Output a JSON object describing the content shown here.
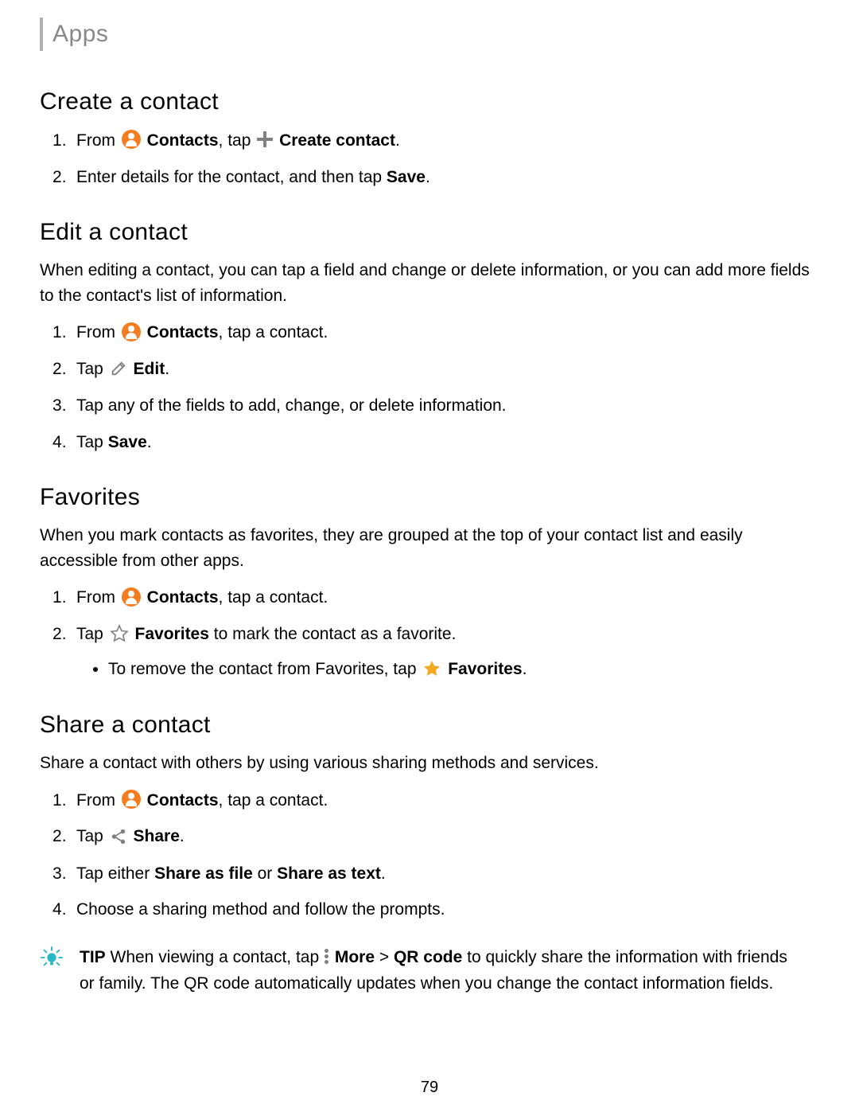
{
  "header": {
    "label": "Apps"
  },
  "sections": {
    "create": {
      "title": "Create a contact",
      "step1_a": "From ",
      "step1_contacts": "Contacts",
      "step1_b": ", tap ",
      "step1_action": "Create contact",
      "step1_c": ".",
      "step2_a": "Enter details for the contact, and then tap ",
      "step2_save": "Save",
      "step2_b": "."
    },
    "edit": {
      "title": "Edit a contact",
      "desc": "When editing a contact, you can tap a field and change or delete information, or you can add more fields to the contact's list of information.",
      "step1_a": "From ",
      "step1_contacts": "Contacts",
      "step1_b": ", tap a contact.",
      "step2_a": "Tap ",
      "step2_action": "Edit",
      "step2_b": ".",
      "step3": "Tap any of the fields to add, change, or delete information.",
      "step4_a": "Tap ",
      "step4_save": "Save",
      "step4_b": "."
    },
    "favorites": {
      "title": "Favorites",
      "desc": "When you mark contacts as favorites, they are grouped at the top of your contact list and easily accessible from other apps.",
      "step1_a": "From ",
      "step1_contacts": "Contacts",
      "step1_b": ", tap a contact.",
      "step2_a": "Tap ",
      "step2_action": "Favorites",
      "step2_b": " to mark the contact as a favorite.",
      "sub_a": "To remove the contact from Favorites, tap ",
      "sub_action": "Favorites",
      "sub_b": "."
    },
    "share": {
      "title": "Share a contact",
      "desc": "Share a contact with others by using various sharing methods and services.",
      "step1_a": "From ",
      "step1_contacts": "Contacts",
      "step1_b": ", tap a contact.",
      "step2_a": "Tap ",
      "step2_action": "Share",
      "step2_b": ".",
      "step3_a": "Tap either ",
      "step3_file": "Share as file",
      "step3_or": " or ",
      "step3_text": "Share as text",
      "step3_b": ".",
      "step4": "Choose a sharing method and follow the prompts."
    }
  },
  "tip": {
    "label": "TIP",
    "a": "  When viewing a contact, tap ",
    "more": "More",
    "gt": " > ",
    "qr": "QR code",
    "b": " to quickly share the information with friends or family. The QR code automatically updates when you change the contact information fields."
  },
  "page_number": "79"
}
